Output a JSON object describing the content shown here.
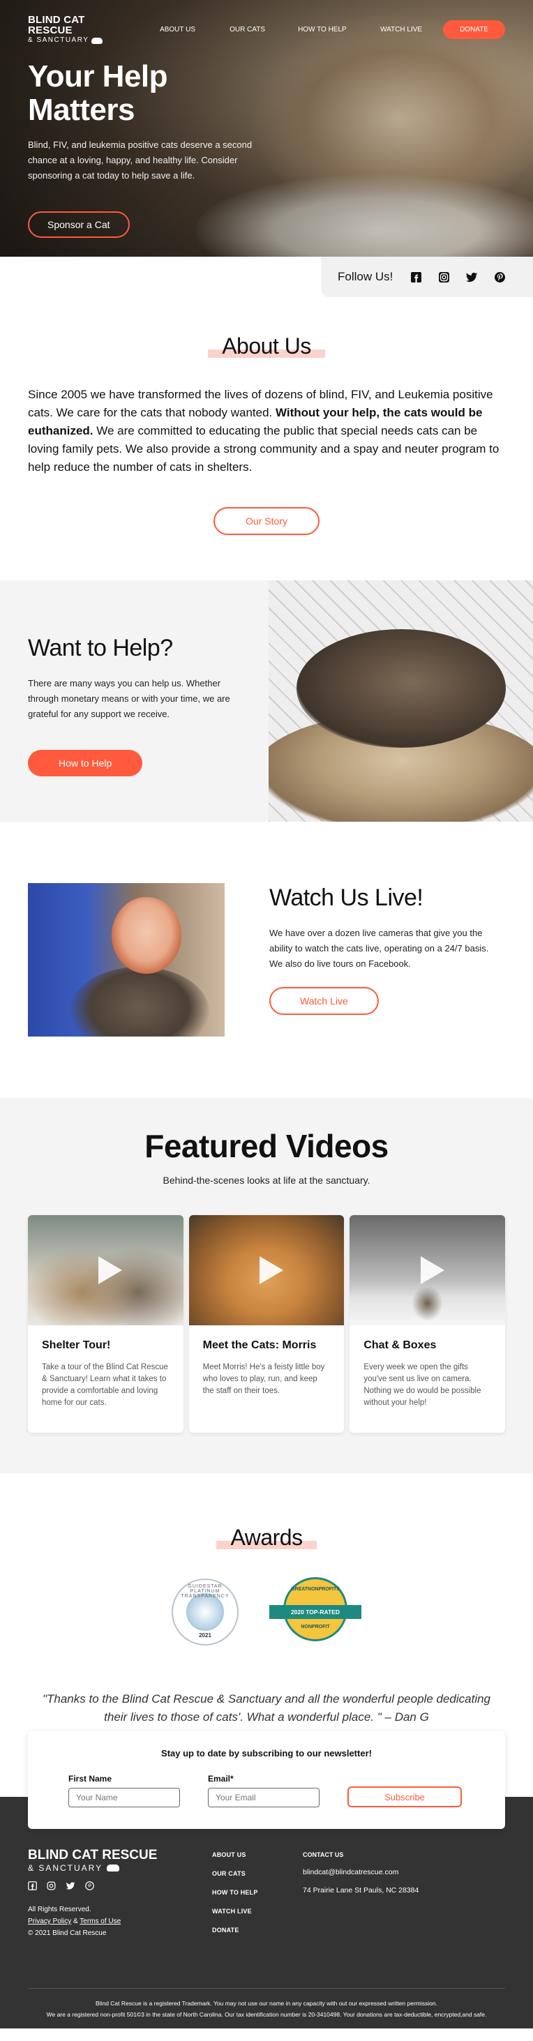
{
  "nav": {
    "logo_line1": "BLIND CAT RESCUE",
    "logo_line2": "& SANCTUARY",
    "links": [
      "ABOUT US",
      "OUR CATS",
      "HOW TO HELP",
      "WATCH LIVE"
    ],
    "donate": "DONATE"
  },
  "hero": {
    "title": "Your Help Matters",
    "text": "Blind, FIV, and leukemia positive cats deserve a second chance at a loving, happy, and healthy life. Consider sponsoring a cat today to help save a life.",
    "button": "Sponsor a Cat"
  },
  "follow": {
    "label": "Follow Us!",
    "icons": [
      "facebook-icon",
      "instagram-icon",
      "twitter-icon",
      "pinterest-icon"
    ]
  },
  "about": {
    "title": "About Us",
    "text_a": "Since 2005 we have transformed the lives of dozens of blind, FIV, and Leukemia positive cats. We care for the cats that nobody wanted. ",
    "text_bold": "Without your help, the cats would be euthanized.",
    "text_b": " We are committed to educating the public that special needs cats can be loving family pets. We also provide a strong community and a spay and neuter program to help reduce the number of cats in shelters.",
    "button": "Our Story"
  },
  "help": {
    "title": "Want to Help?",
    "text": "There are many ways you can help us. Whether through monetary means or with your time, we are grateful for any support we receive.",
    "button": "How to Help"
  },
  "live": {
    "title": "Watch Us Live!",
    "text": "We have over a dozen live cameras that give you the ability to watch the cats live, operating on a 24/7 basis. We also do live tours on Facebook.",
    "button": "Watch Live"
  },
  "videos": {
    "title": "Featured Videos",
    "subtitle": "Behind-the-scenes looks at life at the sanctuary.",
    "cards": [
      {
        "title": "Shelter Tour!",
        "text": "Take a tour of the Blind Cat Rescue & Sanctuary! Learn what it takes to provide a comfortable and loving home for our cats."
      },
      {
        "title": "Meet the Cats: Morris",
        "text": "Meet Morris! He's a feisty little boy who loves to play, run, and keep the staff on their toes."
      },
      {
        "title": "Chat & Boxes",
        "text": "Every week we open the gifts you've sent us live on camera. Nothing we do would be possible without your help!"
      }
    ]
  },
  "awards": {
    "title": "Awards",
    "badge1_ring": "GUIDESTAR PLATINUM TRANSPARENCY",
    "badge1_year": "2021",
    "badge2_top": "GREATNONPROFITS",
    "badge2_ribbon": "2020 TOP-RATED",
    "badge2_bottom": "NONPROFIT",
    "quote": "\"Thanks to the Blind Cat Rescue & Sanctuary and all the wonderful people dedicating their lives to those of cats'. What a wonderful place. \" – Dan G"
  },
  "newsletter": {
    "title": "Stay up to date by subscribing to our newsletter!",
    "first_name_label": "First Name",
    "first_name_placeholder": "Your Name",
    "email_label": "Email*",
    "email_placeholder": "Your Email",
    "button": "Subscribe"
  },
  "footer": {
    "logo_line1": "BLIND CAT RESCUE",
    "logo_line2": "& SANCTUARY",
    "rights": "All Rights Reserved.",
    "privacy": "Privacy Policy",
    "amp": " & ",
    "terms": "Terms of Use",
    "copyright": "© 2021 Blind Cat Rescue",
    "links": [
      "ABOUT US",
      "OUR CATS",
      "HOW TO HELP",
      "WATCH LIVE",
      "DONATE"
    ],
    "contact_title": "CONTACT US",
    "email": "blindcat@blindcatrescue.com",
    "address": "74 Prairie Lane St Pauls, NC 28384",
    "legal1": "Blind Cat Rescue is a registered Trademark. You may not use our name in any capacity with out our expressed written permission.",
    "legal2": "We are a registered non-profit 501©3 in the state of North Carolina.  Our tax identification number is 20-3410498.  Your donations are tax-deductible, encrypted,and safe."
  },
  "colors": {
    "accent": "#ff5a3d",
    "title_highlight": "#fbd3ca",
    "footer_bg": "#333333",
    "section_bg": "#f4f4f4"
  }
}
